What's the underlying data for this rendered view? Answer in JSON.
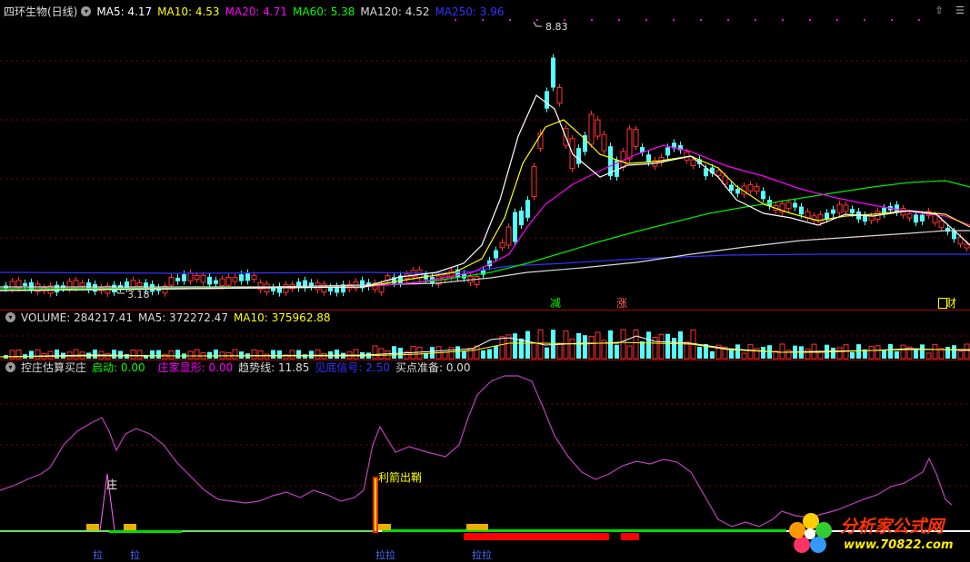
{
  "main_header": {
    "title": "四环生物(日线)",
    "ma5": "MA5: 4.17",
    "ma10": "MA10: 4.53",
    "ma20": "MA20: 4.71",
    "ma60": "MA60: 5.38",
    "ma120": "MA120: 4.52",
    "ma250": "MA250: 3.96"
  },
  "price_labels": {
    "high": "8.83",
    "low": "3.18"
  },
  "event_labels": {
    "reduce": "减",
    "rise": "涨",
    "report": "财"
  },
  "volume_header": {
    "volume": "VOLUME: 284217.41",
    "ma5": "MA5: 372272.47",
    "ma10": "MA10: 375962.88"
  },
  "indicator_header": {
    "name": "控庄估算买庄",
    "start": "启动: 0.00",
    "dealer": "庄家显形: 0.00",
    "trend": "趋势线: 11.85",
    "signal": "见底信号: 2.50",
    "prep": "买点准备: 0.00"
  },
  "indicator_labels": {
    "zhuang": "庄",
    "arrow": "利箭出鞘",
    "la1": "拉",
    "la2": "拉",
    "la3": "拉拉",
    "la4": "拉拉"
  },
  "watermark": {
    "brand": "分析家公式网",
    "url": "www.70822.com"
  },
  "colors": {
    "up": "#ff3232",
    "down": "#54ffff",
    "ma5": "#ffffff",
    "ma10": "#ffff00",
    "ma20": "#ff00ff",
    "ma60": "#00ff00",
    "ma120": "#dddddd",
    "ma250": "#3333ff",
    "grid": "#8b0000",
    "trend": "#c040c0"
  },
  "corner": {
    "up_icon": "up-arrow-icon",
    "menu_icon": "menu-icon"
  }
}
